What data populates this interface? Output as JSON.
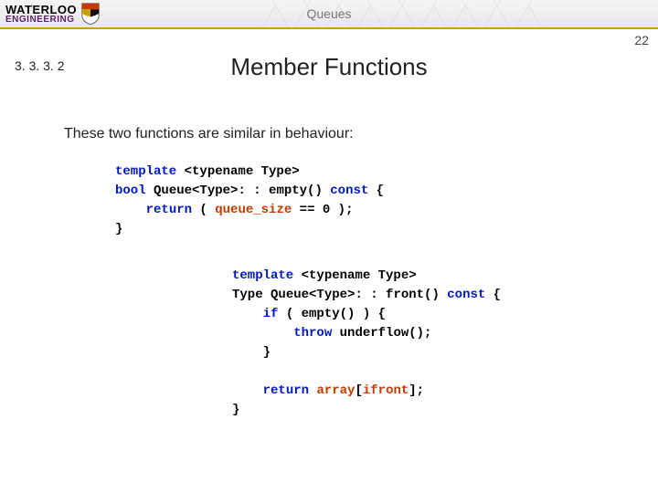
{
  "header": {
    "logo_top": "WATERLOO",
    "logo_bottom": "ENGINEERING",
    "topic": "Queues"
  },
  "page_number": "22",
  "section_number": "3. 3. 3. 2",
  "title": "Member Functions",
  "intro": "These two functions are similar in behaviour:",
  "code1": {
    "l1_kw": "template",
    "l1_rest": " <typename Type>",
    "l2_kw": "bool",
    "l2_name": " Queue<Type>",
    "l2_rest": ": : empty() ",
    "l2_kw2": "const",
    "l2_brace": " {",
    "l3_indent": "    ",
    "l3_kw": "return",
    "l3_open": " ( ",
    "l3_var": "queue_size",
    "l3_rest": " == 0 );",
    "l4": "}"
  },
  "code2": {
    "l1_kw": "template",
    "l1_rest": " <typename Type>",
    "l2_type": "Type",
    "l2_name": " Queue<Type>",
    "l2_rest": ": : front() ",
    "l2_kw2": "const",
    "l2_brace": " {",
    "l3_indent": "    ",
    "l3_kw": "if",
    "l3_rest": " ( empty() ) {",
    "l4_indent": "        ",
    "l4_kw": "throw",
    "l4_rest": " underflow();",
    "l5_indent": "    ",
    "l5": "}",
    "blank": "",
    "l6_indent": "    ",
    "l6_kw": "return",
    "l6_sp": " ",
    "l6_var1": "array",
    "l6_br": "[",
    "l6_var2": "ifront",
    "l6_end": "];",
    "l7": "}"
  }
}
